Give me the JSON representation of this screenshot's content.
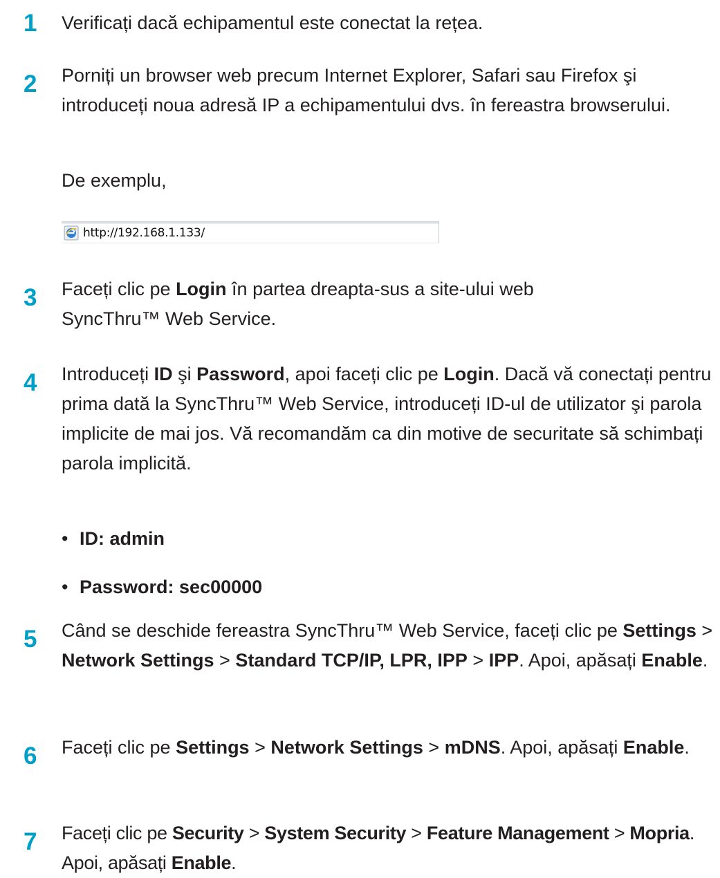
{
  "steps": [
    {
      "number": "1",
      "text": "Verificați dacă echipamentul este conectat la rețea."
    },
    {
      "number": "2",
      "text": "Porniți un browser web precum Internet Explorer, Safari sau Firefox şi introduceți noua adresă IP a echipamentului dvs. în fereastra browserului."
    },
    {
      "number": "3",
      "parts": [
        "Faceți clic pe ",
        "Login",
        " în partea dreapta-sus a site-ului web SyncThru™ Web Service."
      ]
    },
    {
      "number": "4",
      "parts": [
        "Introduceți ",
        "ID",
        " şi ",
        "Password",
        ", apoi faceți clic pe ",
        "Login",
        ". Dacă vă conectați pentru prima dată la SyncThru™ Web Service, introduceți ID-ul de utilizator şi parola implicite de mai jos. Vă recomandăm ca din motive de securitate să schimbați parola implicită."
      ]
    },
    {
      "number": "5",
      "parts": [
        "Când se deschide fereastra SyncThru™ Web Service, faceți clic pe ",
        "Settings",
        " > ",
        "Network Settings",
        " > ",
        "Standard TCP/IP, LPR, IPP",
        " > ",
        "IPP",
        ". Apoi, apăsați ",
        "Enable",
        "."
      ]
    },
    {
      "number": "6",
      "parts": [
        "Faceți clic pe ",
        "Settings",
        " > ",
        "Network Settings",
        " > ",
        "mDNS",
        ". Apoi, apăsați ",
        "Enable",
        "."
      ]
    },
    {
      "number": "7",
      "parts": [
        "Faceți clic pe ",
        "Security",
        " > ",
        "System Security",
        " > ",
        "Feature Management",
        " > ",
        "Mopria",
        ". Apoi, apăsați ",
        "Enable",
        "."
      ]
    }
  ],
  "example_label": "De exemplu,",
  "address_bar": {
    "url": "http://192.168.1.133/",
    "icon": "internet-explorer-icon"
  },
  "credentials": [
    {
      "bullet": "•",
      "text": "ID: admin"
    },
    {
      "bullet": "•",
      "text": "Password: sec00000"
    }
  ],
  "colors": {
    "step_number": "#00a0c6",
    "text": "#231f20"
  }
}
